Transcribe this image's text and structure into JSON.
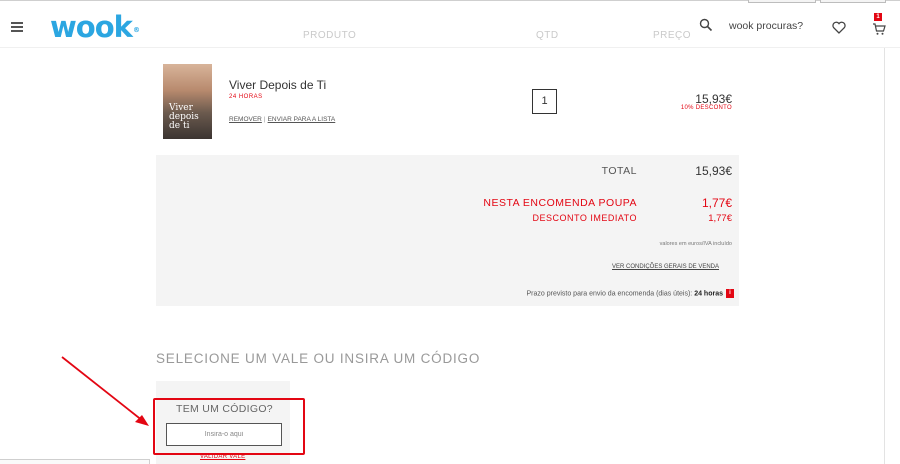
{
  "header": {
    "logo_text": "wook",
    "logo_mark": "®",
    "col_product": "PRODUTO",
    "col_qty": "QTD",
    "col_price": "PREÇO",
    "search_placeholder": "wook procuras?",
    "cart_count": "1",
    "icons": [
      "menu-icon",
      "search-icon",
      "heart-icon",
      "cart-icon"
    ]
  },
  "cart_item": {
    "title": "Viver Depois de Ti",
    "delivery": "24 HORAS",
    "remove_label": "REMOVER",
    "save_label": "ENVIAR PARA A LISTA",
    "quantity": "1",
    "price": "15,93€",
    "discount": "10% DESCONTO",
    "cover_text": "Viver depois de ti"
  },
  "summary": {
    "total_label": "TOTAL",
    "total_value": "15,93€",
    "savings_label": "NESTA ENCOMENDA POUPA",
    "savings_value": "1,77€",
    "instant_label": "DESCONTO IMEDIATO",
    "instant_value": "1,77€",
    "vat_note": "valores em euros/IVA incluído",
    "conditions_link": "VER CONDIÇÕES GERAIS DE VENDA",
    "delivery_note": "Prazo previsto para envio da encomenda (dias úteis):",
    "delivery_time": "24 horas",
    "info_icon_glyph": "i"
  },
  "voucher": {
    "section_title": "SELECIONE UM VALE OU INSIRA UM CÓDIGO",
    "code_title": "TEM UM CÓDIGO?",
    "code_placeholder": "Insira-o aqui",
    "validate_label": "VALIDAR VALE"
  },
  "colors": {
    "brand": "#2ba6e1",
    "accent_red": "#e30613",
    "panel_grey": "#f4f4f4"
  }
}
